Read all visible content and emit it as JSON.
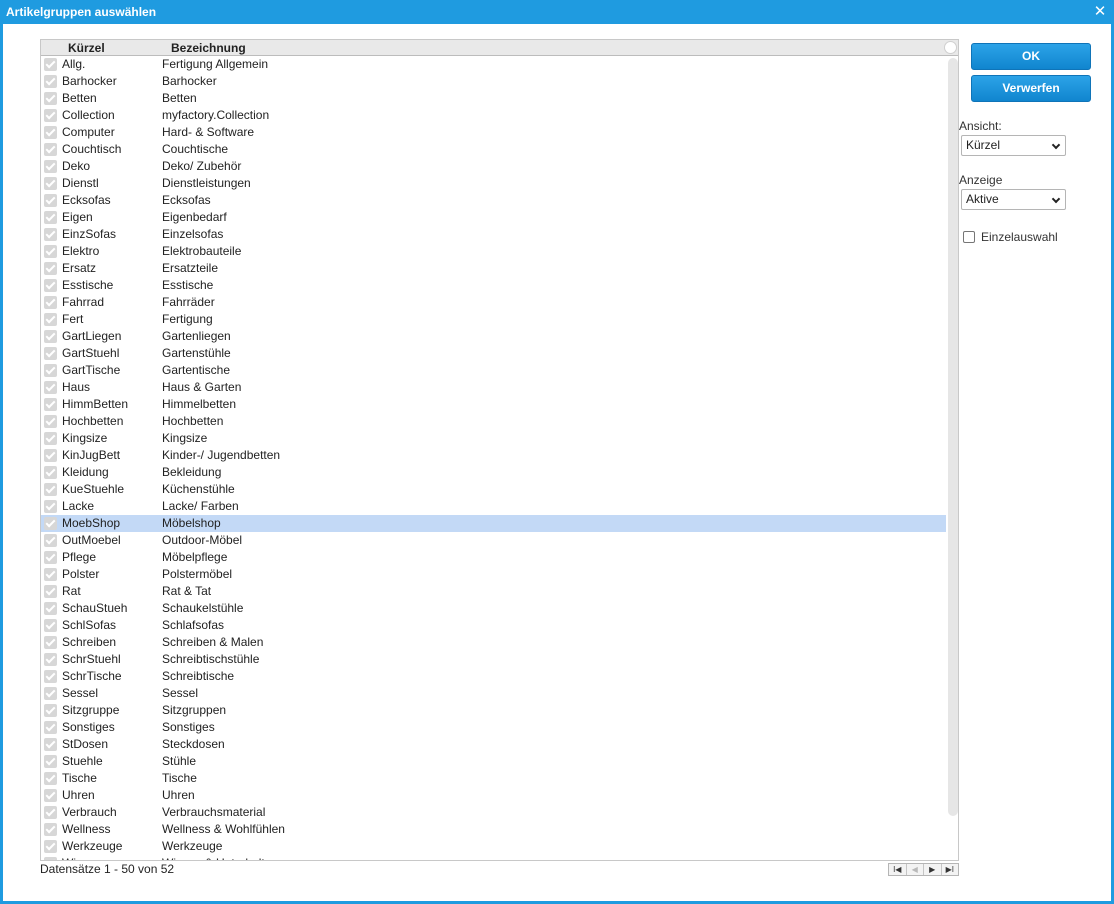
{
  "window": {
    "title": "Artikelgruppen auswählen",
    "close_symbol": "✕"
  },
  "grid": {
    "columns": [
      "Kürzel",
      "Bezeichnung"
    ],
    "rows": [
      {
        "k": "Allg.",
        "b": "Fertigung Allgemein"
      },
      {
        "k": "Barhocker",
        "b": "Barhocker"
      },
      {
        "k": "Betten",
        "b": "Betten"
      },
      {
        "k": "Collection",
        "b": "myfactory.Collection"
      },
      {
        "k": "Computer",
        "b": "Hard- & Software"
      },
      {
        "k": "Couchtisch",
        "b": "Couchtische"
      },
      {
        "k": "Deko",
        "b": "Deko/ Zubehör"
      },
      {
        "k": "Dienstl",
        "b": "Dienstleistungen"
      },
      {
        "k": "Ecksofas",
        "b": "Ecksofas"
      },
      {
        "k": "Eigen",
        "b": "Eigenbedarf"
      },
      {
        "k": "EinzSofas",
        "b": "Einzelsofas"
      },
      {
        "k": "Elektro",
        "b": "Elektrobauteile"
      },
      {
        "k": "Ersatz",
        "b": "Ersatzteile"
      },
      {
        "k": "Esstische",
        "b": "Esstische"
      },
      {
        "k": "Fahrrad",
        "b": "Fahrräder"
      },
      {
        "k": "Fert",
        "b": "Fertigung"
      },
      {
        "k": "GartLiegen",
        "b": "Gartenliegen"
      },
      {
        "k": "GartStuehl",
        "b": "Gartenstühle"
      },
      {
        "k": "GartTische",
        "b": "Gartentische"
      },
      {
        "k": "Haus",
        "b": "Haus & Garten"
      },
      {
        "k": "HimmBetten",
        "b": "Himmelbetten"
      },
      {
        "k": "Hochbetten",
        "b": "Hochbetten"
      },
      {
        "k": "Kingsize",
        "b": "Kingsize"
      },
      {
        "k": "KinJugBett",
        "b": "Kinder-/ Jugendbetten"
      },
      {
        "k": "Kleidung",
        "b": "Bekleidung"
      },
      {
        "k": "KueStuehle",
        "b": "Küchenstühle"
      },
      {
        "k": "Lacke",
        "b": "Lacke/ Farben"
      },
      {
        "k": "MoebShop",
        "b": "Möbelshop",
        "selected": true
      },
      {
        "k": "OutMoebel",
        "b": "Outdoor-Möbel"
      },
      {
        "k": "Pflege",
        "b": "Möbelpflege"
      },
      {
        "k": "Polster",
        "b": "Polstermöbel"
      },
      {
        "k": "Rat",
        "b": "Rat & Tat"
      },
      {
        "k": "SchauStueh",
        "b": "Schaukelstühle"
      },
      {
        "k": "SchlSofas",
        "b": "Schlafsofas"
      },
      {
        "k": "Schreiben",
        "b": "Schreiben & Malen"
      },
      {
        "k": "SchrStuehl",
        "b": "Schreibtischstühle"
      },
      {
        "k": "SchrTische",
        "b": "Schreibtische"
      },
      {
        "k": "Sessel",
        "b": "Sessel"
      },
      {
        "k": "Sitzgruppe",
        "b": "Sitzgruppen"
      },
      {
        "k": "Sonstiges",
        "b": "Sonstiges"
      },
      {
        "k": "StDosen",
        "b": "Steckdosen"
      },
      {
        "k": "Stuehle",
        "b": "Stühle"
      },
      {
        "k": "Tische",
        "b": "Tische"
      },
      {
        "k": "Uhren",
        "b": "Uhren"
      },
      {
        "k": "Verbrauch",
        "b": "Verbrauchsmaterial"
      },
      {
        "k": "Wellness",
        "b": "Wellness & Wohlfühlen"
      },
      {
        "k": "Werkzeuge",
        "b": "Werkzeuge"
      },
      {
        "k": "Wissen",
        "b": "Wissen & Unterhaltung"
      }
    ]
  },
  "footer": {
    "records_text": "Datensätze 1 - 50 von 52",
    "pager": [
      "I◀",
      "◀",
      "▶",
      "▶I"
    ]
  },
  "panel": {
    "ok_label": "OK",
    "cancel_label": "Verwerfen",
    "ansicht_label": "Ansicht:",
    "ansicht_value": "Kürzel",
    "anzeige_label": "Anzeige",
    "anzeige_value": "Aktive",
    "einzel_label": "Einzelauswahl"
  },
  "colors": {
    "accent": "#1f9be0",
    "selection": "#c3d9f6"
  }
}
